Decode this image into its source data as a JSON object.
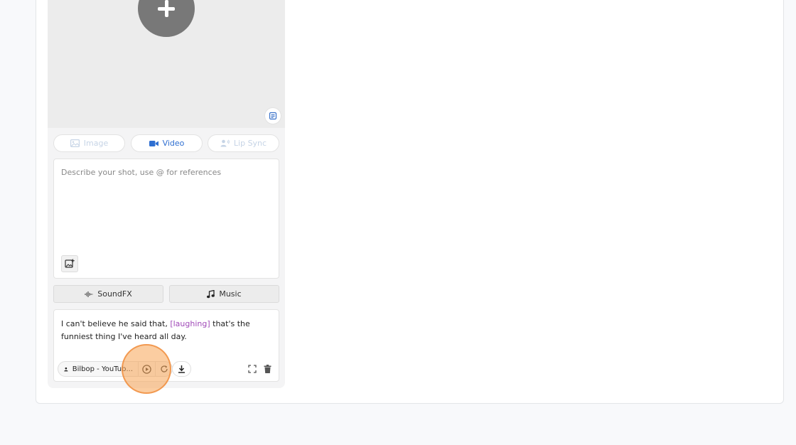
{
  "tabs": [
    {
      "label": "Image",
      "icon": "image-icon",
      "state": "disabled"
    },
    {
      "label": "Video",
      "icon": "video-camera-icon",
      "state": "active"
    },
    {
      "label": "Lip Sync",
      "icon": "user-voice-icon",
      "state": "disabled"
    }
  ],
  "prompt": {
    "placeholder": "Describe your shot, use @ for references",
    "value": ""
  },
  "audio_buttons": {
    "soundfx_label": "SoundFX",
    "music_label": "Music"
  },
  "dialogue": {
    "text_before": "I can't believe he said that, ",
    "tag": "[laughing]",
    "text_after": " that's the funniest thing I've heard all day."
  },
  "voice": {
    "name": "Bilbop - YouTub..."
  },
  "colors": {
    "active_tab": "#2f6fd1",
    "disabled_tab": "#c6d4e6",
    "audio_tag": "#a04ab8",
    "click_highlight": "#f7a454"
  }
}
